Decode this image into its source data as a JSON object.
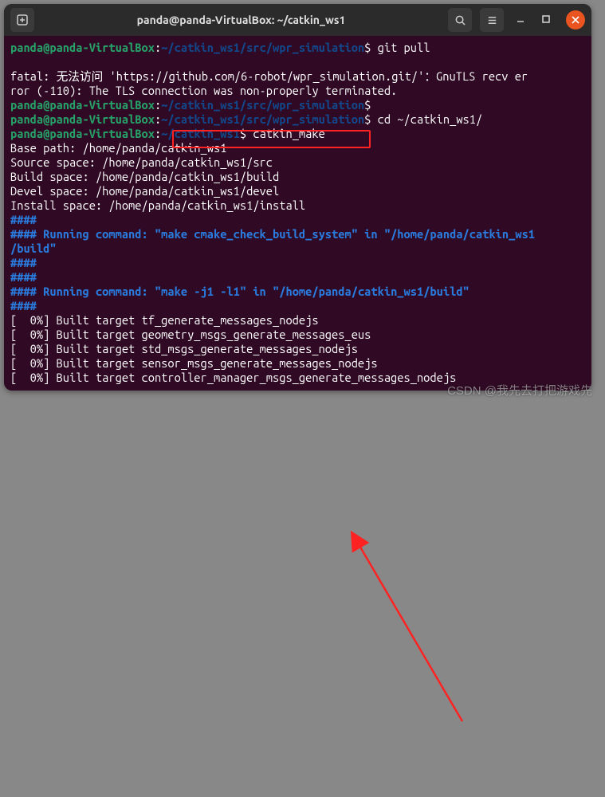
{
  "titlebar": {
    "title": "panda@panda-VirtualBox: ~/catkin_ws1"
  },
  "term": {
    "user_host": "panda@panda-VirtualBox",
    "p1_path": "~/catkin_ws1/src/wpr_simulation",
    "p2_path": "~/catkin_ws1",
    "cmd_git_pull": "git pull",
    "cmd_cd": "cd ~/catkin_ws1/",
    "cmd_make": "catkin_make",
    "err_line1": "fatal: 无法访问 'https://github.com/6-robot/wpr_simulation.git/'：GnuTLS recv er",
    "err_line2": "ror (-110): The TLS connection was non-properly terminated.",
    "base_path": "Base path: /home/panda/catkin_ws1",
    "source_space": "Source space: /home/panda/catkin_ws1/src",
    "build_space": "Build space: /home/panda/catkin_ws1/build",
    "devel_space": "Devel space: /home/panda/catkin_ws1/devel",
    "install_space": "Install space: /home/panda/catkin_ws1/install",
    "hash": "####",
    "run_label": "#### Running command: ",
    "run_cmd1": "\"make cmake_check_build_system\"",
    "run_in": " in ",
    "run_dir1a": "\"/home/panda/catkin_ws1",
    "run_dir1b": "/build\"",
    "run_cmd2": "\"make -j1 -l1\"",
    "run_dir2": "\"/home/panda/catkin_ws1/build\"",
    "tgt1": "[  0%] Built target tf_generate_messages_nodejs",
    "tgt2": "[  0%] Built target geometry_msgs_generate_messages_eus",
    "tgt3": "[  0%] Built target std_msgs_generate_messages_nodejs",
    "tgt4": "[  0%] Built target sensor_msgs_generate_messages_nodejs",
    "tgt5": "[  0%] Built target controller_manager_msgs_generate_messages_nodejs"
  },
  "watermark": "CSDN @我先去打把游戏先"
}
